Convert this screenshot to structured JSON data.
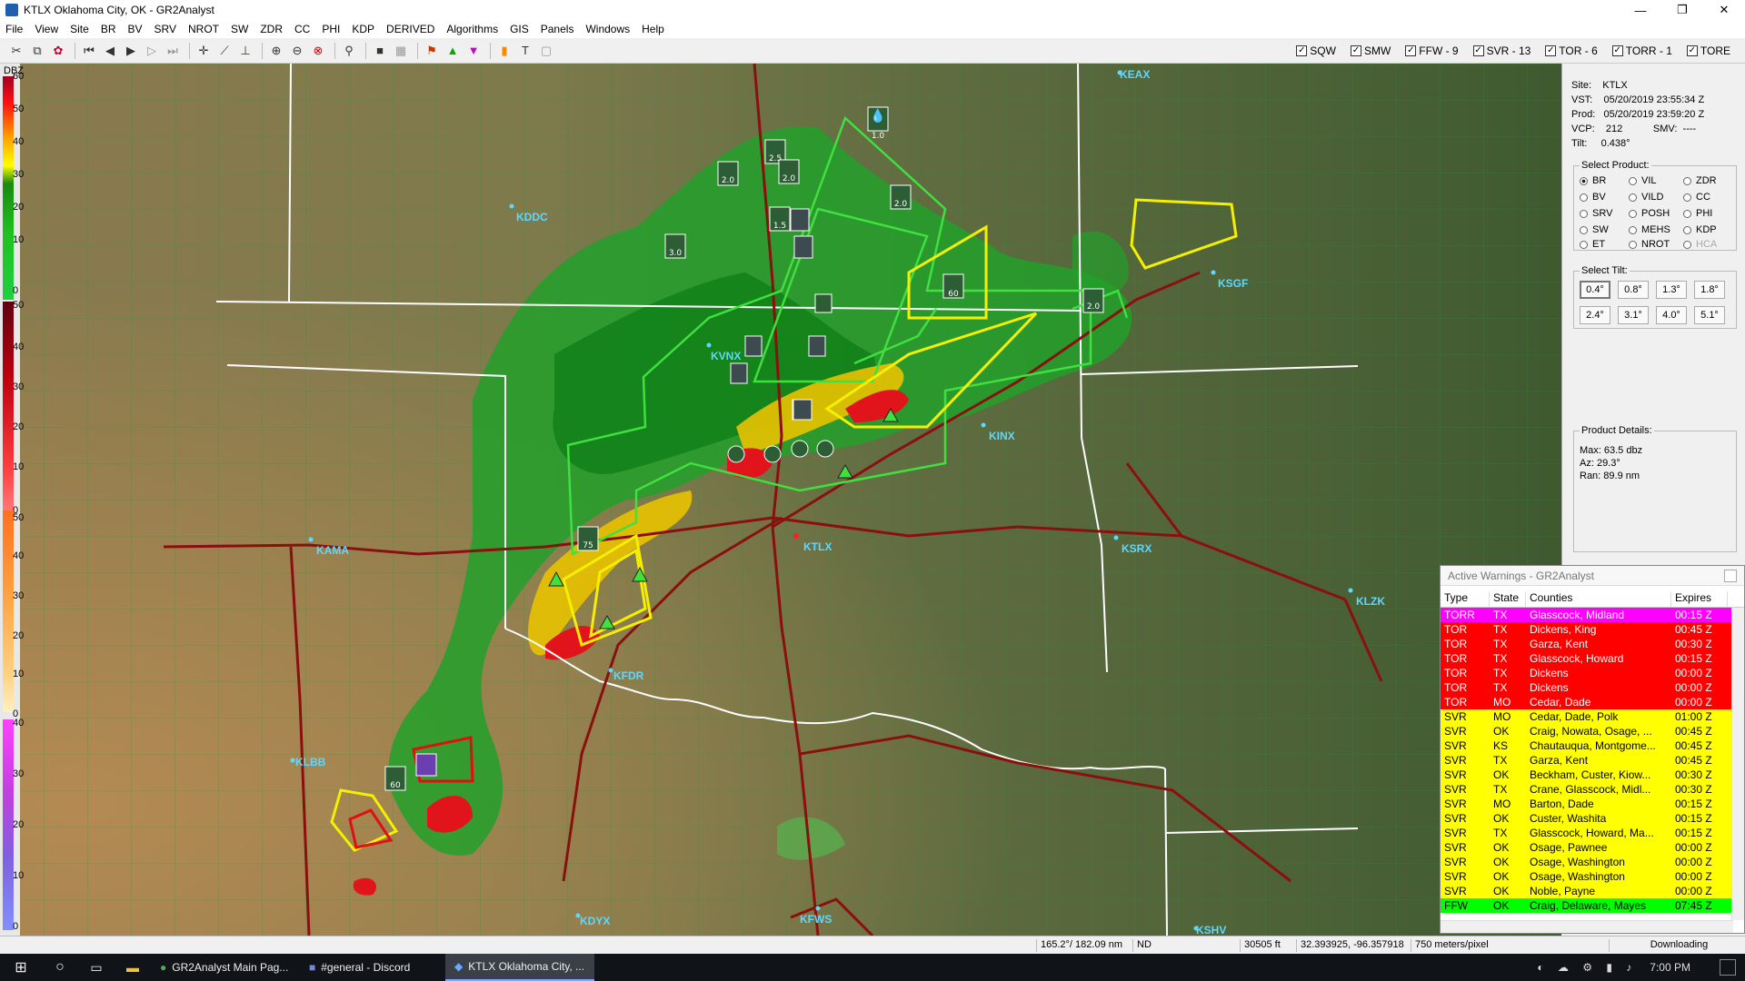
{
  "window": {
    "title": "KTLX Oklahoma City, OK - GR2Analyst",
    "minimize": "—",
    "maximize": "❐",
    "close": "✕"
  },
  "menu": [
    "File",
    "View",
    "Site",
    "BR",
    "BV",
    "SRV",
    "NROT",
    "SW",
    "ZDR",
    "CC",
    "PHI",
    "KDP",
    "DERIVED",
    "Algorithms",
    "GIS",
    "Panels",
    "Windows",
    "Help"
  ],
  "toolbar": {
    "icons": [
      "cut-icon",
      "copy-icon",
      "palette-icon",
      "skip-start-icon",
      "step-back-icon",
      "play-icon",
      "step-forward-icon",
      "skip-end-icon",
      "crosshair-icon",
      "ruler-icon",
      "pin-icon",
      "zoom-in-icon",
      "zoom-out-icon",
      "zoom-reset-icon",
      "wand-icon",
      "square-icon",
      "grid-icon",
      "flag-icon",
      "triangle-up-icon",
      "triangle-down-icon",
      "fill-icon",
      "text-icon",
      "frame-icon"
    ]
  },
  "filters": [
    {
      "label": "SQW",
      "checked": true
    },
    {
      "label": "SMW",
      "checked": true
    },
    {
      "label": "FFW - 9",
      "checked": true
    },
    {
      "label": "SVR - 13",
      "checked": true
    },
    {
      "label": "TOR - 6",
      "checked": true
    },
    {
      "label": "TORR - 1",
      "checked": true
    },
    {
      "label": "TORE",
      "checked": true
    }
  ],
  "legend": {
    "title": "DBZ",
    "top_ticks": [
      "60",
      "50",
      "40",
      "30",
      "20",
      "10",
      "0"
    ],
    "red_ticks": [
      "50",
      "40",
      "30",
      "20",
      "10",
      "0"
    ],
    "orange_ticks": [
      "50",
      "40",
      "30",
      "20",
      "10",
      "0"
    ],
    "purple_ticks": [
      "40",
      "30",
      "20",
      "10",
      "0"
    ]
  },
  "map_labels": {
    "keax": "KEAX",
    "kddc": "KDDC",
    "ksgf": "KSGF",
    "kvnx": "KVNX",
    "kinx": "KINX",
    "ktlx": "KTLX",
    "ksrx": "KSRX",
    "kama": "KAMA",
    "klzk": "KLZK",
    "kfdr": "KFDR",
    "klbb": "KLBB",
    "kdyx": "KDYX",
    "kfws": "KFWS",
    "kshv": "KSHV"
  },
  "map_markers": {
    "hail_values": [
      "1.0",
      "2.0",
      "2.5",
      "2.0",
      "2.0",
      "3.0",
      "1.5",
      "2.0"
    ],
    "wind_values": [
      "60",
      "75",
      "60"
    ]
  },
  "site_info": {
    "site_label": "Site:",
    "site": "KTLX",
    "vst_label": "VST:",
    "vst": "05/20/2019  23:55:34 Z",
    "prod_label": "Prod:",
    "prod": "05/20/2019  23:59:20 Z",
    "vcp_label": "VCP:",
    "vcp": "212",
    "smv_label": "SMV:",
    "smv": "----",
    "tilt_label": "Tilt:",
    "tilt": "0.438°"
  },
  "select_product": {
    "title": "Select Product:",
    "options": [
      {
        "label": "BR",
        "selected": true,
        "disabled": false
      },
      {
        "label": "VIL",
        "selected": false,
        "disabled": false
      },
      {
        "label": "ZDR",
        "selected": false,
        "disabled": false
      },
      {
        "label": "BV",
        "selected": false,
        "disabled": false
      },
      {
        "label": "VILD",
        "selected": false,
        "disabled": false
      },
      {
        "label": "CC",
        "selected": false,
        "disabled": false
      },
      {
        "label": "SRV",
        "selected": false,
        "disabled": false
      },
      {
        "label": "POSH",
        "selected": false,
        "disabled": false
      },
      {
        "label": "PHI",
        "selected": false,
        "disabled": false
      },
      {
        "label": "SW",
        "selected": false,
        "disabled": false
      },
      {
        "label": "MEHS",
        "selected": false,
        "disabled": false
      },
      {
        "label": "KDP",
        "selected": false,
        "disabled": false
      },
      {
        "label": "ET",
        "selected": false,
        "disabled": false
      },
      {
        "label": "NROT",
        "selected": false,
        "disabled": false
      },
      {
        "label": "HCA",
        "selected": false,
        "disabled": true
      }
    ]
  },
  "select_tilt": {
    "title": "Select Tilt:",
    "tilts": [
      "0.4°",
      "0.8°",
      "1.3°",
      "1.8°",
      "2.4°",
      "3.1°",
      "4.0°",
      "5.1°"
    ],
    "selected": "0.4°"
  },
  "product_details": {
    "title": "Product Details:",
    "max": "Max:  63.5 dbz",
    "az": "Az:   29.3°",
    "ran": "Ran:  89.9 nm"
  },
  "warnings": {
    "title": "Active Warnings - GR2Analyst",
    "columns": [
      "Type",
      "State",
      "Counties",
      "Expires"
    ],
    "rows": [
      {
        "type": "TORR",
        "state": "TX",
        "counties": "Glasscock, Midland",
        "expires": "00:15 Z",
        "bg": "#ff00ff",
        "fg": "#ffffff"
      },
      {
        "type": "TOR",
        "state": "TX",
        "counties": "Dickens, King",
        "expires": "00:45 Z",
        "bg": "#ff0000",
        "fg": "#ffffff"
      },
      {
        "type": "TOR",
        "state": "TX",
        "counties": "Garza, Kent",
        "expires": "00:30 Z",
        "bg": "#ff0000",
        "fg": "#ffffff"
      },
      {
        "type": "TOR",
        "state": "TX",
        "counties": "Glasscock, Howard",
        "expires": "00:15 Z",
        "bg": "#ff0000",
        "fg": "#ffffff"
      },
      {
        "type": "TOR",
        "state": "TX",
        "counties": "Dickens",
        "expires": "00:00 Z",
        "bg": "#ff0000",
        "fg": "#ffffff"
      },
      {
        "type": "TOR",
        "state": "TX",
        "counties": "Dickens",
        "expires": "00:00 Z",
        "bg": "#ff0000",
        "fg": "#ffffff"
      },
      {
        "type": "TOR",
        "state": "MO",
        "counties": "Cedar, Dade",
        "expires": "00:00 Z",
        "bg": "#ff0000",
        "fg": "#ffffff"
      },
      {
        "type": "SVR",
        "state": "MO",
        "counties": "Cedar, Dade, Polk",
        "expires": "01:00 Z",
        "bg": "#ffff00",
        "fg": "#000000"
      },
      {
        "type": "SVR",
        "state": "OK",
        "counties": "Craig, Nowata, Osage, ...",
        "expires": "00:45 Z",
        "bg": "#ffff00",
        "fg": "#000000"
      },
      {
        "type": "SVR",
        "state": "KS",
        "counties": "Chautauqua, Montgome...",
        "expires": "00:45 Z",
        "bg": "#ffff00",
        "fg": "#000000"
      },
      {
        "type": "SVR",
        "state": "TX",
        "counties": "Garza, Kent",
        "expires": "00:45 Z",
        "bg": "#ffff00",
        "fg": "#000000"
      },
      {
        "type": "SVR",
        "state": "OK",
        "counties": "Beckham, Custer, Kiow...",
        "expires": "00:30 Z",
        "bg": "#ffff00",
        "fg": "#000000"
      },
      {
        "type": "SVR",
        "state": "TX",
        "counties": "Crane, Glasscock, Midl...",
        "expires": "00:30 Z",
        "bg": "#ffff00",
        "fg": "#000000"
      },
      {
        "type": "SVR",
        "state": "MO",
        "counties": "Barton, Dade",
        "expires": "00:15 Z",
        "bg": "#ffff00",
        "fg": "#000000"
      },
      {
        "type": "SVR",
        "state": "OK",
        "counties": "Custer, Washita",
        "expires": "00:15 Z",
        "bg": "#ffff00",
        "fg": "#000000"
      },
      {
        "type": "SVR",
        "state": "TX",
        "counties": "Glasscock, Howard, Ma...",
        "expires": "00:15 Z",
        "bg": "#ffff00",
        "fg": "#000000"
      },
      {
        "type": "SVR",
        "state": "OK",
        "counties": "Osage, Pawnee",
        "expires": "00:00 Z",
        "bg": "#ffff00",
        "fg": "#000000"
      },
      {
        "type": "SVR",
        "state": "OK",
        "counties": "Osage, Washington",
        "expires": "00:00 Z",
        "bg": "#ffff00",
        "fg": "#000000"
      },
      {
        "type": "SVR",
        "state": "OK",
        "counties": "Osage, Washington",
        "expires": "00:00 Z",
        "bg": "#ffff00",
        "fg": "#000000"
      },
      {
        "type": "SVR",
        "state": "OK",
        "counties": "Noble, Payne",
        "expires": "00:00 Z",
        "bg": "#ffff00",
        "fg": "#000000"
      },
      {
        "type": "FFW",
        "state": "OK",
        "counties": "Craig, Delaware, Mayes",
        "expires": "07:45 Z",
        "bg": "#00ff00",
        "fg": "#000000"
      }
    ]
  },
  "status": {
    "bearing": "165.2°/ 182.09 nm",
    "nd": "ND",
    "height": "30505 ft",
    "coords": "32.393925, -96.357918",
    "scale": "750 meters/pixel",
    "download": "Downloading"
  },
  "taskbar": {
    "items": [
      {
        "label": "GR2Analyst Main Pag...",
        "active": false
      },
      {
        "label": "#general - Discord",
        "active": false
      },
      {
        "label": "KTLX Oklahoma City, ...",
        "active": true
      }
    ],
    "clock": "7:00 PM"
  }
}
